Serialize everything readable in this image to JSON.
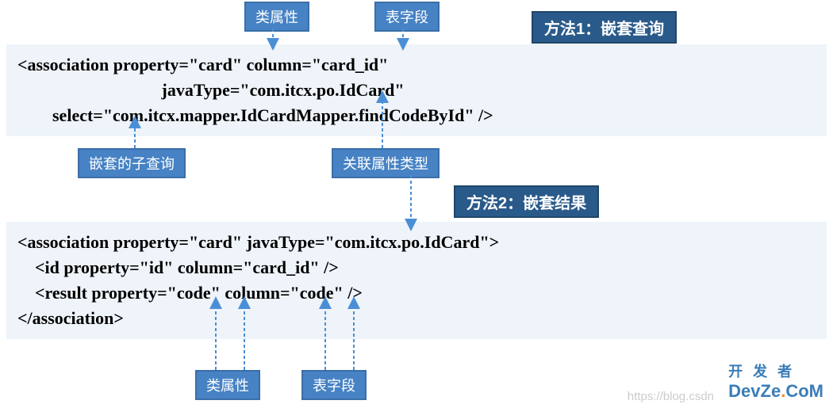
{
  "labels": {
    "class_property_top": "类属性",
    "table_field_top": "表字段",
    "nested_subquery": "嵌套的子查询",
    "assoc_type": "关联属性类型",
    "class_property_bottom": "类属性",
    "table_field_bottom": "表字段"
  },
  "titles": {
    "method1": "方法1：嵌套查询",
    "method2": "方法2：嵌套结果"
  },
  "code1": {
    "l1": "<association property=\"card\" column=\"card_id\"",
    "l2": "                                 javaType=\"com.itcx.po.IdCard\"",
    "l3": "        select=\"com.itcx.mapper.IdCardMapper.findCodeById\" />"
  },
  "code2": {
    "l1": "<association property=\"card\" javaType=\"com.itcx.po.IdCard\">",
    "l2": "    <id property=\"id\" column=\"card_id\" />",
    "l3": "    <result property=\"code\" column=\"code\" />",
    "l4": "</association>"
  },
  "watermark": {
    "url": "https://blog.csdn",
    "brand1": "开 发 者",
    "brand2_a": "DevZe",
    "brand2_b": ".",
    "brand2_c": "CoM"
  }
}
